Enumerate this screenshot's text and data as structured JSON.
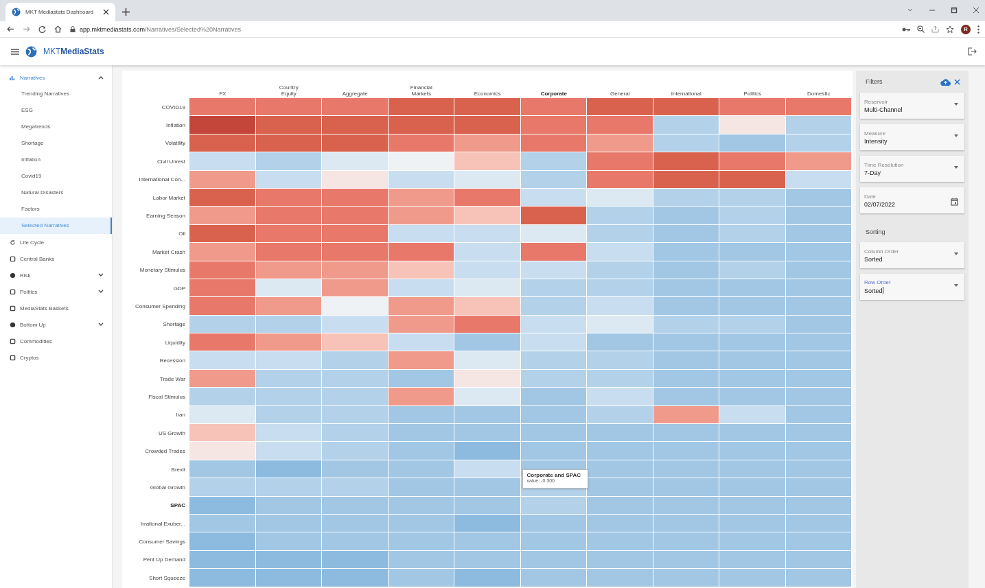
{
  "browser": {
    "tab_title": "MKT Mediastats Dashboard",
    "url_host": "app.mktmediastats.com",
    "url_path": "/Narratives/Selected%20Narratives",
    "avatar": "R"
  },
  "app": {
    "logo": "MKT**MediaStats**"
  },
  "sidebar": {
    "items": [
      {
        "label": "Narratives",
        "expanded": true,
        "children": [
          {
            "label": "Trending Narratives",
            "selected": false
          },
          {
            "label": "ESG",
            "selected": false
          },
          {
            "label": "Megatrends",
            "selected": false
          },
          {
            "label": "Shortage",
            "selected": false
          },
          {
            "label": "Inflation",
            "selected": false
          },
          {
            "label": "Covid19",
            "selected": false
          },
          {
            "label": "Natural Disasters",
            "selected": false
          },
          {
            "label": "Factors",
            "selected": false
          },
          {
            "label": "Selected Narratives",
            "selected": true
          }
        ]
      },
      {
        "label": "Life Cycle"
      },
      {
        "label": "Central Banks"
      },
      {
        "label": "Risk",
        "expanded": false
      },
      {
        "label": "Politics",
        "expanded": false
      },
      {
        "label": "MediaStats Baskets"
      },
      {
        "label": "Bottom Up",
        "expanded": false
      },
      {
        "label": "Commodities"
      },
      {
        "label": "Cryptos"
      }
    ]
  },
  "heatmap": {
    "columns": [
      {
        "label": "FX",
        "selected": false
      },
      {
        "label": "Country\nEquity",
        "selected": false
      },
      {
        "label": "Aggregate",
        "selected": false
      },
      {
        "label": "Financial\nMarkets",
        "selected": false
      },
      {
        "label": "Economics",
        "selected": false
      },
      {
        "label": "Corporate",
        "selected": true
      },
      {
        "label": "General",
        "selected": false
      },
      {
        "label": "International",
        "selected": false
      },
      {
        "label": "Politics",
        "selected": false
      },
      {
        "label": "Domestic",
        "selected": false
      }
    ],
    "rows": [
      {
        "label": "COVID19",
        "selected": false,
        "cells": [
          {
            "color": "#e7786a"
          },
          {
            "color": "#e7786a"
          },
          {
            "color": "#e7786a"
          },
          {
            "color": "#d9624f"
          },
          {
            "color": "#d9624f"
          },
          {
            "color": "#e7786a"
          },
          {
            "color": "#d9624f"
          },
          {
            "color": "#d9624f"
          },
          {
            "color": "#e7786a"
          },
          {
            "color": "#e7786a"
          }
        ]
      },
      {
        "label": "Inflation",
        "selected": false,
        "cells": [
          {
            "color": "#c4453a"
          },
          {
            "color": "#d9624f"
          },
          {
            "color": "#d9624f"
          },
          {
            "color": "#d9624f"
          },
          {
            "color": "#d9624f"
          },
          {
            "color": "#e7786a"
          },
          {
            "color": "#e7786a"
          },
          {
            "color": "#b3d2ea"
          },
          {
            "color": "#f6e6e3"
          },
          {
            "color": "#b3d2ea"
          }
        ]
      },
      {
        "label": "Volatility",
        "selected": false,
        "cells": [
          {
            "color": "#d9624f"
          },
          {
            "color": "#d9624f"
          },
          {
            "color": "#d9624f"
          },
          {
            "color": "#e7786a"
          },
          {
            "color": "#f09a8b"
          },
          {
            "color": "#e7786a"
          },
          {
            "color": "#f09a8b"
          },
          {
            "color": "#b3d2ea"
          },
          {
            "color": "#a1c7e5"
          },
          {
            "color": "#b3d2ea"
          }
        ]
      },
      {
        "label": "Civil Unrest",
        "selected": false,
        "cells": [
          {
            "color": "#c8def0"
          },
          {
            "color": "#b3d2ea"
          },
          {
            "color": "#dde9f2"
          },
          {
            "color": "#eef2f4"
          },
          {
            "color": "#f7c3b8"
          },
          {
            "color": "#b3d2ea"
          },
          {
            "color": "#e7786a"
          },
          {
            "color": "#d9624f"
          },
          {
            "color": "#e7786a"
          },
          {
            "color": "#f09a8b"
          }
        ]
      },
      {
        "label": "International Con...",
        "selected": false,
        "cells": [
          {
            "color": "#f09a8b"
          },
          {
            "color": "#c8def0"
          },
          {
            "color": "#f6e6e3"
          },
          {
            "color": "#c8def0"
          },
          {
            "color": "#dde9f2"
          },
          {
            "color": "#b3d2ea"
          },
          {
            "color": "#e7786a"
          },
          {
            "color": "#d9624f"
          },
          {
            "color": "#d9624f"
          },
          {
            "color": "#c8def0"
          }
        ]
      },
      {
        "label": "Labor Market",
        "selected": false,
        "cells": [
          {
            "color": "#d9624f"
          },
          {
            "color": "#e7786a"
          },
          {
            "color": "#e7786a"
          },
          {
            "color": "#f09a8b"
          },
          {
            "color": "#e7786a"
          },
          {
            "color": "#c8def0"
          },
          {
            "color": "#dde9f2"
          },
          {
            "color": "#b3d2ea"
          },
          {
            "color": "#b3d2ea"
          },
          {
            "color": "#a1c7e5"
          }
        ]
      },
      {
        "label": "Earning Season",
        "selected": false,
        "cells": [
          {
            "color": "#f09a8b"
          },
          {
            "color": "#e7786a"
          },
          {
            "color": "#e7786a"
          },
          {
            "color": "#f09a8b"
          },
          {
            "color": "#f7c3b8"
          },
          {
            "color": "#d9624f"
          },
          {
            "color": "#b3d2ea"
          },
          {
            "color": "#a1c7e5"
          },
          {
            "color": "#b3d2ea"
          },
          {
            "color": "#a1c7e5"
          }
        ]
      },
      {
        "label": "Oil",
        "selected": false,
        "cells": [
          {
            "color": "#d9624f"
          },
          {
            "color": "#e7786a"
          },
          {
            "color": "#e7786a"
          },
          {
            "color": "#c8def0"
          },
          {
            "color": "#c8def0"
          },
          {
            "color": "#dde9f2"
          },
          {
            "color": "#b3d2ea"
          },
          {
            "color": "#a1c7e5"
          },
          {
            "color": "#b3d2ea"
          },
          {
            "color": "#a1c7e5"
          }
        ]
      },
      {
        "label": "Market Crash",
        "selected": false,
        "cells": [
          {
            "color": "#f09a8b"
          },
          {
            "color": "#e7786a"
          },
          {
            "color": "#e7786a"
          },
          {
            "color": "#e7786a"
          },
          {
            "color": "#c8def0"
          },
          {
            "color": "#e7786a"
          },
          {
            "color": "#c8def0"
          },
          {
            "color": "#a1c7e5"
          },
          {
            "color": "#a1c7e5"
          },
          {
            "color": "#a1c7e5"
          }
        ]
      },
      {
        "label": "Monetary Stimulus",
        "selected": false,
        "cells": [
          {
            "color": "#e7786a"
          },
          {
            "color": "#f09a8b"
          },
          {
            "color": "#f09a8b"
          },
          {
            "color": "#f7c3b8"
          },
          {
            "color": "#c8def0"
          },
          {
            "color": "#c8def0"
          },
          {
            "color": "#b3d2ea"
          },
          {
            "color": "#a1c7e5"
          },
          {
            "color": "#b3d2ea"
          },
          {
            "color": "#a1c7e5"
          }
        ]
      },
      {
        "label": "GDP",
        "selected": false,
        "cells": [
          {
            "color": "#e7786a"
          },
          {
            "color": "#dde9f2"
          },
          {
            "color": "#f09a8b"
          },
          {
            "color": "#c8def0"
          },
          {
            "color": "#dde9f2"
          },
          {
            "color": "#b3d2ea"
          },
          {
            "color": "#b3d2ea"
          },
          {
            "color": "#a1c7e5"
          },
          {
            "color": "#a1c7e5"
          },
          {
            "color": "#a1c7e5"
          }
        ]
      },
      {
        "label": "Consumer Spending",
        "selected": false,
        "cells": [
          {
            "color": "#e7786a"
          },
          {
            "color": "#f09a8b"
          },
          {
            "color": "#eef2f4"
          },
          {
            "color": "#f09a8b"
          },
          {
            "color": "#f7c3b8"
          },
          {
            "color": "#b3d2ea"
          },
          {
            "color": "#c8def0"
          },
          {
            "color": "#a1c7e5"
          },
          {
            "color": "#a1c7e5"
          },
          {
            "color": "#a1c7e5"
          }
        ]
      },
      {
        "label": "Shortage",
        "selected": false,
        "cells": [
          {
            "color": "#b3d2ea"
          },
          {
            "color": "#b3d2ea"
          },
          {
            "color": "#c8def0"
          },
          {
            "color": "#f09a8b"
          },
          {
            "color": "#e7786a"
          },
          {
            "color": "#c8def0"
          },
          {
            "color": "#dde9f2"
          },
          {
            "color": "#b3d2ea"
          },
          {
            "color": "#b3d2ea"
          },
          {
            "color": "#a1c7e5"
          }
        ]
      },
      {
        "label": "Liquidity",
        "selected": false,
        "cells": [
          {
            "color": "#e7786a"
          },
          {
            "color": "#f09a8b"
          },
          {
            "color": "#f7c3b8"
          },
          {
            "color": "#c8def0"
          },
          {
            "color": "#a1c7e5"
          },
          {
            "color": "#c8def0"
          },
          {
            "color": "#a1c7e5"
          },
          {
            "color": "#a1c7e5"
          },
          {
            "color": "#a1c7e5"
          },
          {
            "color": "#a1c7e5"
          }
        ]
      },
      {
        "label": "Recession",
        "selected": false,
        "cells": [
          {
            "color": "#c8def0"
          },
          {
            "color": "#c8def0"
          },
          {
            "color": "#b3d2ea"
          },
          {
            "color": "#f09a8b"
          },
          {
            "color": "#dde9f2"
          },
          {
            "color": "#b3d2ea"
          },
          {
            "color": "#b3d2ea"
          },
          {
            "color": "#a1c7e5"
          },
          {
            "color": "#a1c7e5"
          },
          {
            "color": "#a1c7e5"
          }
        ]
      },
      {
        "label": "Trade War",
        "selected": false,
        "cells": [
          {
            "color": "#f09a8b"
          },
          {
            "color": "#b3d2ea"
          },
          {
            "color": "#b3d2ea"
          },
          {
            "color": "#a1c7e5"
          },
          {
            "color": "#f6e6e3"
          },
          {
            "color": "#b3d2ea"
          },
          {
            "color": "#b3d2ea"
          },
          {
            "color": "#a1c7e5"
          },
          {
            "color": "#a1c7e5"
          },
          {
            "color": "#a1c7e5"
          }
        ]
      },
      {
        "label": "Fiscal Stimulus",
        "selected": false,
        "cells": [
          {
            "color": "#b3d2ea"
          },
          {
            "color": "#b3d2ea"
          },
          {
            "color": "#b3d2ea"
          },
          {
            "color": "#f09a8b"
          },
          {
            "color": "#dde9f2"
          },
          {
            "color": "#a1c7e5"
          },
          {
            "color": "#c8def0"
          },
          {
            "color": "#a1c7e5"
          },
          {
            "color": "#a1c7e5"
          },
          {
            "color": "#a1c7e5"
          }
        ]
      },
      {
        "label": "Iran",
        "selected": false,
        "cells": [
          {
            "color": "#dde9f2"
          },
          {
            "color": "#b3d2ea"
          },
          {
            "color": "#b3d2ea"
          },
          {
            "color": "#a1c7e5"
          },
          {
            "color": "#a1c7e5"
          },
          {
            "color": "#a1c7e5"
          },
          {
            "color": "#b3d2ea"
          },
          {
            "color": "#f09a8b"
          },
          {
            "color": "#c8def0"
          },
          {
            "color": "#a1c7e5"
          }
        ]
      },
      {
        "label": "US Growth",
        "selected": false,
        "cells": [
          {
            "color": "#f7c3b8"
          },
          {
            "color": "#c8def0"
          },
          {
            "color": "#b3d2ea"
          },
          {
            "color": "#a1c7e5"
          },
          {
            "color": "#a1c7e5"
          },
          {
            "color": "#a1c7e5"
          },
          {
            "color": "#a1c7e5"
          },
          {
            "color": "#a1c7e5"
          },
          {
            "color": "#a1c7e5"
          },
          {
            "color": "#a1c7e5"
          }
        ]
      },
      {
        "label": "Crowded Trades",
        "selected": false,
        "cells": [
          {
            "color": "#f6e6e3"
          },
          {
            "color": "#c8def0"
          },
          {
            "color": "#b3d2ea"
          },
          {
            "color": "#a1c7e5"
          },
          {
            "color": "#8dbbe0"
          },
          {
            "color": "#a1c7e5"
          },
          {
            "color": "#a1c7e5"
          },
          {
            "color": "#a1c7e5"
          },
          {
            "color": "#a1c7e5"
          },
          {
            "color": "#a1c7e5"
          }
        ]
      },
      {
        "label": "Brexit",
        "selected": false,
        "cells": [
          {
            "color": "#a1c7e5"
          },
          {
            "color": "#8dbbe0"
          },
          {
            "color": "#a1c7e5"
          },
          {
            "color": "#a1c7e5"
          },
          {
            "color": "#c8def0"
          },
          {
            "color": "#a1c7e5"
          },
          {
            "color": "#a1c7e5"
          },
          {
            "color": "#a1c7e5"
          },
          {
            "color": "#a1c7e5"
          },
          {
            "color": "#a1c7e5"
          }
        ]
      },
      {
        "label": "Global Growth",
        "selected": false,
        "cells": [
          {
            "color": "#b3d2ea"
          },
          {
            "color": "#b3d2ea"
          },
          {
            "color": "#b3d2ea"
          },
          {
            "color": "#a1c7e5"
          },
          {
            "color": "#a1c7e5"
          },
          {
            "color": "#b3d2ea"
          },
          {
            "color": "#a1c7e5"
          },
          {
            "color": "#a1c7e5"
          },
          {
            "color": "#a1c7e5"
          },
          {
            "color": "#a1c7e5"
          }
        ]
      },
      {
        "label": "SPAC",
        "selected": true,
        "cells": [
          {
            "color": "#8dbbe0"
          },
          {
            "color": "#a1c7e5"
          },
          {
            "color": "#a1c7e5"
          },
          {
            "color": "#a1c7e5"
          },
          {
            "color": "#a1c7e5"
          },
          {
            "color": "#b3d2ea"
          },
          {
            "color": "#a1c7e5"
          },
          {
            "color": "#a1c7e5"
          },
          {
            "color": "#a1c7e5"
          },
          {
            "color": "#a1c7e5"
          }
        ]
      },
      {
        "label": "Irrational Exuber...",
        "selected": false,
        "cells": [
          {
            "color": "#a1c7e5"
          },
          {
            "color": "#a1c7e5"
          },
          {
            "color": "#a1c7e5"
          },
          {
            "color": "#a1c7e5"
          },
          {
            "color": "#8dbbe0"
          },
          {
            "color": "#a1c7e5"
          },
          {
            "color": "#a1c7e5"
          },
          {
            "color": "#a1c7e5"
          },
          {
            "color": "#a1c7e5"
          },
          {
            "color": "#a1c7e5"
          }
        ]
      },
      {
        "label": "Consumer Savings",
        "selected": false,
        "cells": [
          {
            "color": "#8dbbe0"
          },
          {
            "color": "#a1c7e5"
          },
          {
            "color": "#a1c7e5"
          },
          {
            "color": "#a1c7e5"
          },
          {
            "color": "#a1c7e5"
          },
          {
            "color": "#a1c7e5"
          },
          {
            "color": "#a1c7e5"
          },
          {
            "color": "#a1c7e5"
          },
          {
            "color": "#a1c7e5"
          },
          {
            "color": "#a1c7e5"
          }
        ]
      },
      {
        "label": "Pent Up Demand",
        "selected": false,
        "cells": [
          {
            "color": "#8dbbe0"
          },
          {
            "color": "#8dbbe0"
          },
          {
            "color": "#8dbbe0"
          },
          {
            "color": "#a1c7e5"
          },
          {
            "color": "#a1c7e5"
          },
          {
            "color": "#a1c7e5"
          },
          {
            "color": "#a1c7e5"
          },
          {
            "color": "#a1c7e5"
          },
          {
            "color": "#a1c7e5"
          },
          {
            "color": "#a1c7e5"
          }
        ]
      },
      {
        "label": "Short Squeeze",
        "selected": false,
        "cells": [
          {
            "color": "#8dbbe0"
          },
          {
            "color": "#8dbbe0"
          },
          {
            "color": "#8dbbe0"
          },
          {
            "color": "#a1c7e5"
          },
          {
            "color": "#8dbbe0"
          },
          {
            "color": "#a1c7e5"
          },
          {
            "color": "#a1c7e5"
          },
          {
            "color": "#a1c7e5"
          },
          {
            "color": "#a1c7e5"
          },
          {
            "color": "#a1c7e5"
          }
        ]
      }
    ],
    "tooltip": {
      "title": "Corporate and SPAC",
      "value": "value: -0.300"
    }
  },
  "filters": {
    "title": "Filters",
    "fields": [
      {
        "kind": "select",
        "label": "Reservoir",
        "value": "Multi-Channel",
        "focused": false
      },
      {
        "kind": "select",
        "label": "Measure",
        "value": "Intensity",
        "focused": false
      },
      {
        "kind": "select",
        "label": "Time Resolution",
        "value": "7-Day",
        "focused": false
      },
      {
        "kind": "date",
        "label": "Date",
        "value": "02/07/2022",
        "focused": false
      }
    ],
    "sorting_title": "Sorting",
    "sorting_fields": [
      {
        "kind": "select",
        "label": "Column Order",
        "value": "Sorted",
        "focused": false
      },
      {
        "kind": "select",
        "label": "Row Order",
        "value": "Sorted",
        "focused": true
      }
    ]
  }
}
